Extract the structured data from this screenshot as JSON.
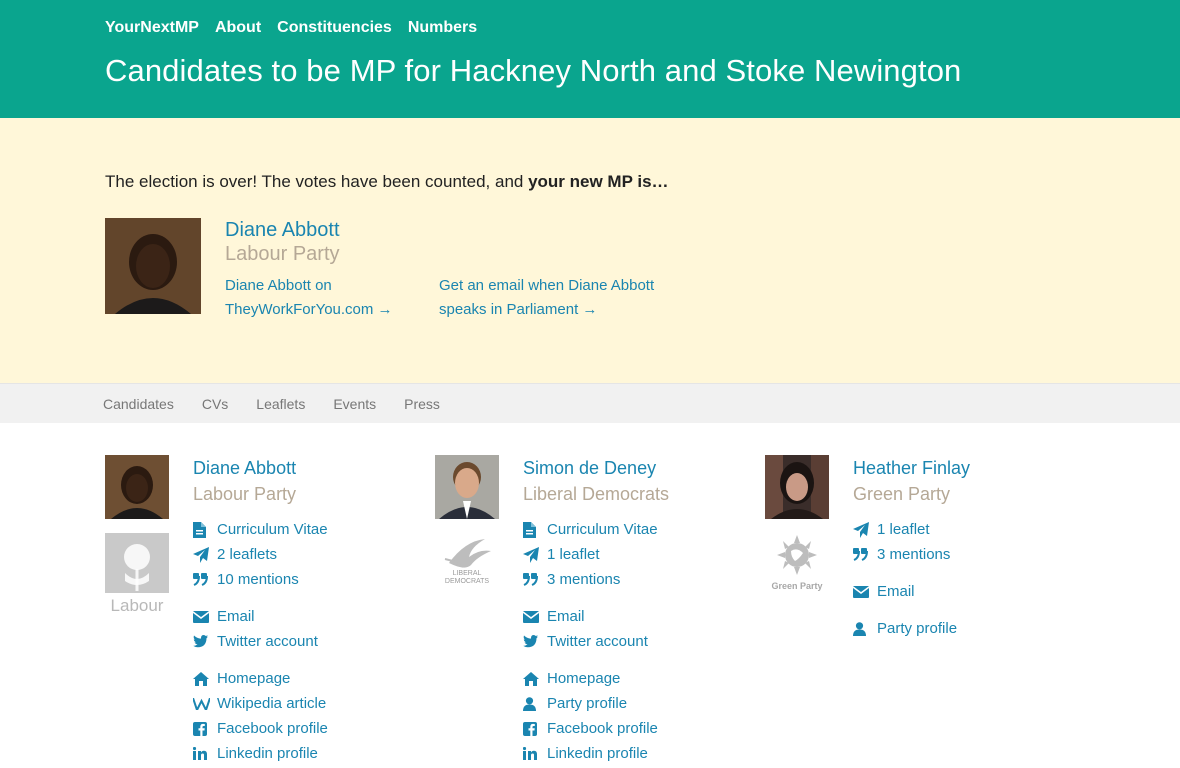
{
  "topnav": {
    "brand": "YourNextMP",
    "about": "About",
    "constituencies": "Constituencies",
    "numbers": "Numbers"
  },
  "page": {
    "title": "Candidates to be MP for Hackney North and Stoke Newington"
  },
  "result": {
    "intro_plain": "The election is over! The votes have been counted, and ",
    "intro_bold": "your new MP is…",
    "winner": {
      "name": "Diane Abbott",
      "party": "Labour Party",
      "twfy_line1": "Diane Abbott on",
      "twfy_line2": "TheyWorkForYou.com →",
      "alert_line1": "Get an email when Diane Abbott",
      "alert_line2": "speaks in Parliament →"
    }
  },
  "subnav": {
    "candidates": "Candidates",
    "cvs": "CVs",
    "leaflets": "Leaflets",
    "events": "Events",
    "press": "Press"
  },
  "candidates": [
    {
      "name": "Diane Abbott",
      "party": "Labour Party",
      "logo_text": "Labour",
      "links": {
        "cv": "Curriculum Vitae",
        "leaflets": "2 leaflets",
        "mentions": "10 mentions",
        "email": "Email",
        "twitter": "Twitter account",
        "homepage": "Homepage",
        "wikipedia": "Wikipedia article",
        "facebook": "Facebook profile",
        "linkedin": "Linkedin profile"
      }
    },
    {
      "name": "Simon de Deney",
      "party": "Liberal Democrats",
      "logo_text_1": "LIBERAL",
      "logo_text_2": "DEMOCRATS",
      "links": {
        "cv": "Curriculum Vitae",
        "leaflets": "1 leaflet",
        "mentions": "3 mentions",
        "email": "Email",
        "twitter": "Twitter account",
        "homepage": "Homepage",
        "party_profile": "Party profile",
        "facebook": "Facebook profile",
        "linkedin": "Linkedin profile"
      }
    },
    {
      "name": "Heather Finlay",
      "party": "Green Party",
      "logo_text": "Green Party",
      "links": {
        "leaflets": "1 leaflet",
        "mentions": "3 mentions",
        "email": "Email",
        "party_profile": "Party profile"
      }
    }
  ],
  "colors": {
    "header": "#0aa58e",
    "result_bg": "#fff7d9",
    "link": "#1a85b0",
    "party": "#b5a896"
  }
}
